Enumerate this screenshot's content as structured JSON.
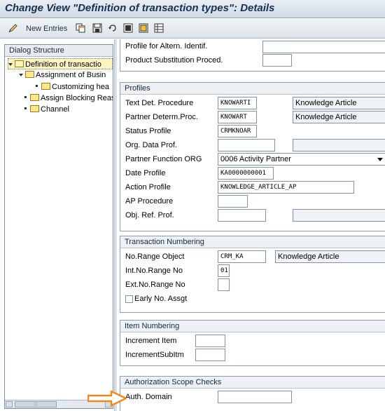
{
  "window": {
    "title": "Change View \"Definition of transaction types\": Details"
  },
  "toolbar": {
    "new_entries_label": "New Entries",
    "icons": [
      "edit-pencil-icon",
      "copy-icon",
      "save-icon",
      "undo-icon",
      "select-all-icon",
      "deselect-icon",
      "details-icon"
    ]
  },
  "dialog_structure": {
    "header": "Dialog Structure",
    "items": [
      {
        "label": "Definition of transactio",
        "level": 0,
        "expanded": true,
        "selected": true
      },
      {
        "label": "Assignment of Busin",
        "level": 1,
        "expanded": true
      },
      {
        "label": "Customizing hea",
        "level": 2
      },
      {
        "label": "Assign Blocking Reas",
        "level": 1
      },
      {
        "label": "Channel",
        "level": 1
      }
    ],
    "scroll_thumb_text": ":::"
  },
  "top_fields": {
    "alt_ident_label": "Profile for Altern. Identif.",
    "alt_ident_value": "",
    "product_subst_label": "Product Substitution Proced.",
    "product_subst_value": ""
  },
  "profiles": {
    "title": "Profiles",
    "text_det_label": "Text Det. Procedure",
    "text_det_value": "KNOWARTI",
    "text_det_desc": "Knowledge Article",
    "partner_det_label": "Partner Determ.Proc.",
    "partner_det_value": "KNOWART",
    "partner_det_desc": "Knowledge Article",
    "status_profile_label": "Status Profile",
    "status_profile_value": "CRMKNOAR",
    "org_data_label": "Org. Data Prof.",
    "org_data_value": "",
    "partner_func_label": "Partner Function ORG",
    "partner_func_value": "0006 Activity Partner",
    "date_profile_label": "Date Profile",
    "date_profile_value": "KA0000000001",
    "action_profile_label": "Action Profile",
    "action_profile_value": "KNOWLEDGE_ARTICLE_AP",
    "ap_procedure_label": "AP Procedure",
    "ap_procedure_value": "",
    "obj_ref_label": "Obj. Ref. Prof.",
    "obj_ref_value": ""
  },
  "transaction_numbering": {
    "title": "Transaction Numbering",
    "no_range_object_label": "No.Range Object",
    "no_range_object_value": "CRM_KA",
    "no_range_object_desc": "Knowledge Article",
    "int_no_range_label": "Int.No.Range No",
    "int_no_range_value": "01",
    "ext_no_range_label": "Ext.No.Range No",
    "ext_no_range_value": "",
    "early_no_label": "Early No. Assgt",
    "early_no_checked": false
  },
  "item_numbering": {
    "title": "Item Numbering",
    "increment_item_label": "Increment Item",
    "increment_item_value": "",
    "increment_sub_label": "IncrementSubItm",
    "increment_sub_value": ""
  },
  "authorization": {
    "title": "Authorization Scope Checks",
    "auth_domain_label": "Auth. Domain",
    "auth_domain_value": ""
  },
  "colors": {
    "arrow": "#f08a1c",
    "selected_tree": "#fdf6c2",
    "title_text": "#18304f"
  }
}
